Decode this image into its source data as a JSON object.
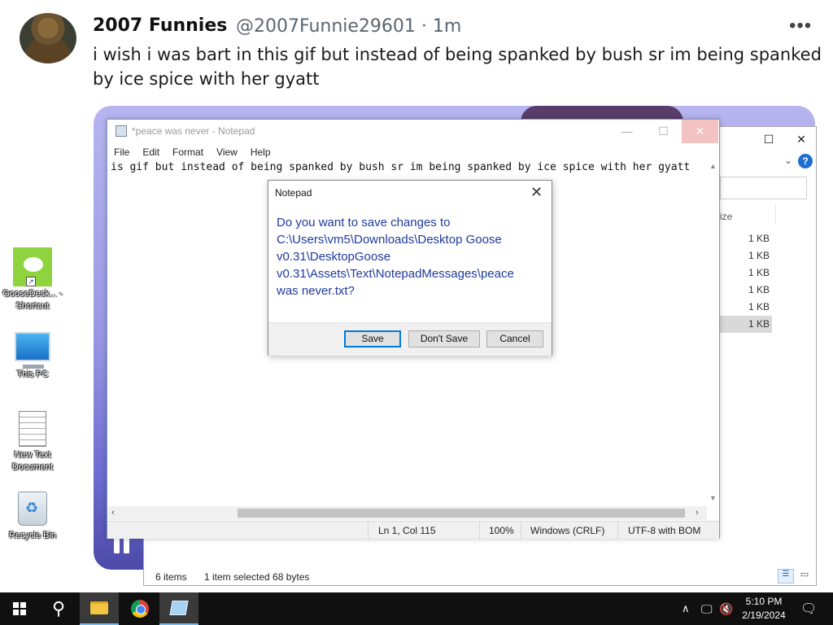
{
  "tweet": {
    "name": "2007 Funnies",
    "handle_time": "@2007Funnie29601 · 1m",
    "more": "•••",
    "text": "i wish i was bart in this gif but instead of being spanked by bush sr im being spanked by ice spice with her gyatt"
  },
  "notepad": {
    "title": "*peace was never - Notepad",
    "menu": [
      "File",
      "Edit",
      "Format",
      "View",
      "Help"
    ],
    "content": "is gif but instead of being spanked by bush sr im being spanked by ice spice with her gyatt",
    "status": {
      "position": "Ln 1, Col 115",
      "zoom": "100%",
      "line_ending": "Windows (CRLF)",
      "encoding": "UTF-8 with BOM"
    }
  },
  "dialog": {
    "title": "Notepad",
    "message": "Do you want to save changes to C:\\Users\\vm5\\Downloads\\Desktop Goose v0.31\\DesktopGoose v0.31\\Assets\\Text\\NotepadMessages\\peace was never.txt?",
    "buttons": {
      "save": "Save",
      "dont_save": "Don't Save",
      "cancel": "Cancel"
    }
  },
  "explorer": {
    "column_header": "ize",
    "sizes": [
      "1 KB",
      "1 KB",
      "1 KB",
      "1 KB",
      "1 KB",
      "1 KB"
    ],
    "selected_index": 5,
    "status_items": "6 items",
    "status_selected": "1 item selected  68 bytes"
  },
  "desktop": {
    "icons": [
      {
        "name": "goose",
        "label": "GooseDesk... - Shortcut"
      },
      {
        "name": "this-pc",
        "label": "This PC"
      },
      {
        "name": "new-text-document",
        "label": "New Text Document"
      },
      {
        "name": "recycle-bin",
        "label": "Recycle Bin"
      }
    ]
  },
  "taskbar": {
    "time": "5:10 PM",
    "date": "2/19/2024",
    "pinned_icons": [
      "windows-start-icon",
      "search-icon",
      "file-explorer-icon",
      "chrome-icon",
      "notepad-icon"
    ],
    "tray_icons": [
      "chevron-up-icon",
      "network-icon",
      "volume-muted-icon",
      "notification-icon"
    ]
  }
}
